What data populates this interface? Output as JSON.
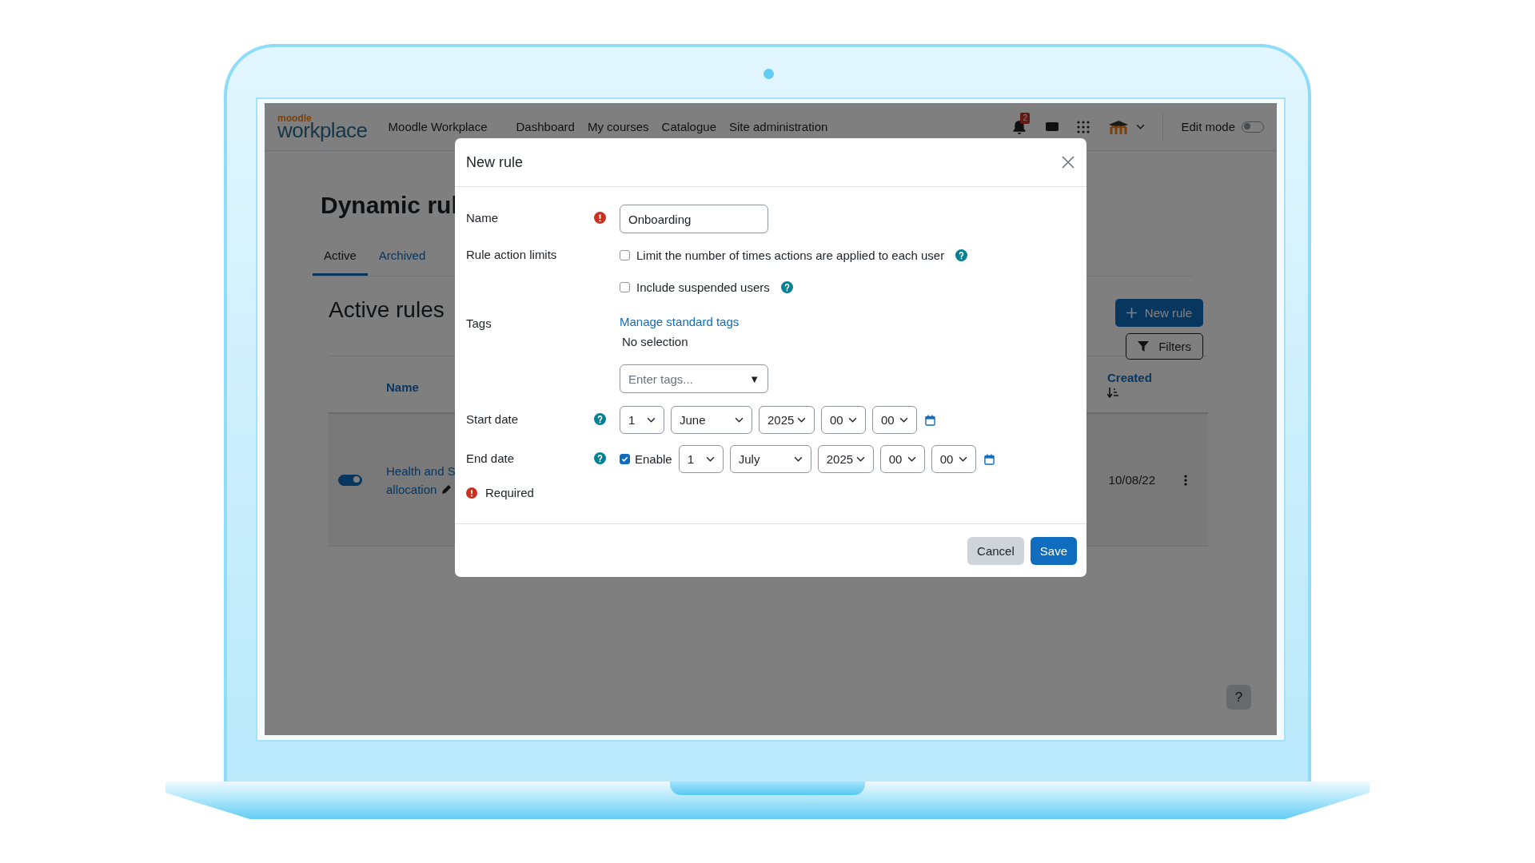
{
  "header": {
    "logo_top": "moodle",
    "logo_main": "workplace",
    "nav": [
      {
        "label": "Moodle Workplace"
      },
      {
        "label": "Dashboard"
      },
      {
        "label": "My courses"
      },
      {
        "label": "Catalogue"
      },
      {
        "label": "Site administration"
      }
    ],
    "notification_count": "2",
    "edit_mode": {
      "label": "Edit mode",
      "on": false
    }
  },
  "page": {
    "title": "Dynamic rul",
    "tabs": [
      {
        "label": "Active",
        "selected": true
      },
      {
        "label": "Archived",
        "selected": false
      }
    ],
    "section_title": "Active rules",
    "new_rule_button": "New rule",
    "filters_button": "Filters",
    "table": {
      "columns": [
        {
          "label": "Name"
        },
        {
          "label": "Created"
        }
      ],
      "rows": [
        {
          "enabled": true,
          "name_lines": [
            "Health and S",
            "allocation"
          ],
          "created": "10/08/22"
        }
      ]
    },
    "help_button": "?"
  },
  "modal": {
    "title": "New rule",
    "name_field": {
      "label": "Name",
      "required": true,
      "value": "Onboarding"
    },
    "rule_action_limits": {
      "label": "Rule action limits",
      "options": [
        {
          "label": "Limit the number of times actions are applied to each user",
          "checked": false
        },
        {
          "label": "Include suspended users",
          "checked": false
        }
      ]
    },
    "tags": {
      "label": "Tags",
      "link": "Manage standard tags",
      "selection": "No selection",
      "placeholder": "Enter tags...",
      "arrow": "▼"
    },
    "start_date": {
      "label": "Start date",
      "selects": [
        "1",
        "June",
        "2025",
        "00",
        "00"
      ]
    },
    "end_date": {
      "label": "End date",
      "enable": {
        "label": "Enable",
        "checked": true
      },
      "selects": [
        "1",
        "July",
        "2025",
        "00",
        "00"
      ]
    },
    "required_note": "Required",
    "buttons": [
      {
        "label": "Cancel",
        "kind": "secondary"
      },
      {
        "label": "Save",
        "kind": "primary"
      }
    ]
  }
}
